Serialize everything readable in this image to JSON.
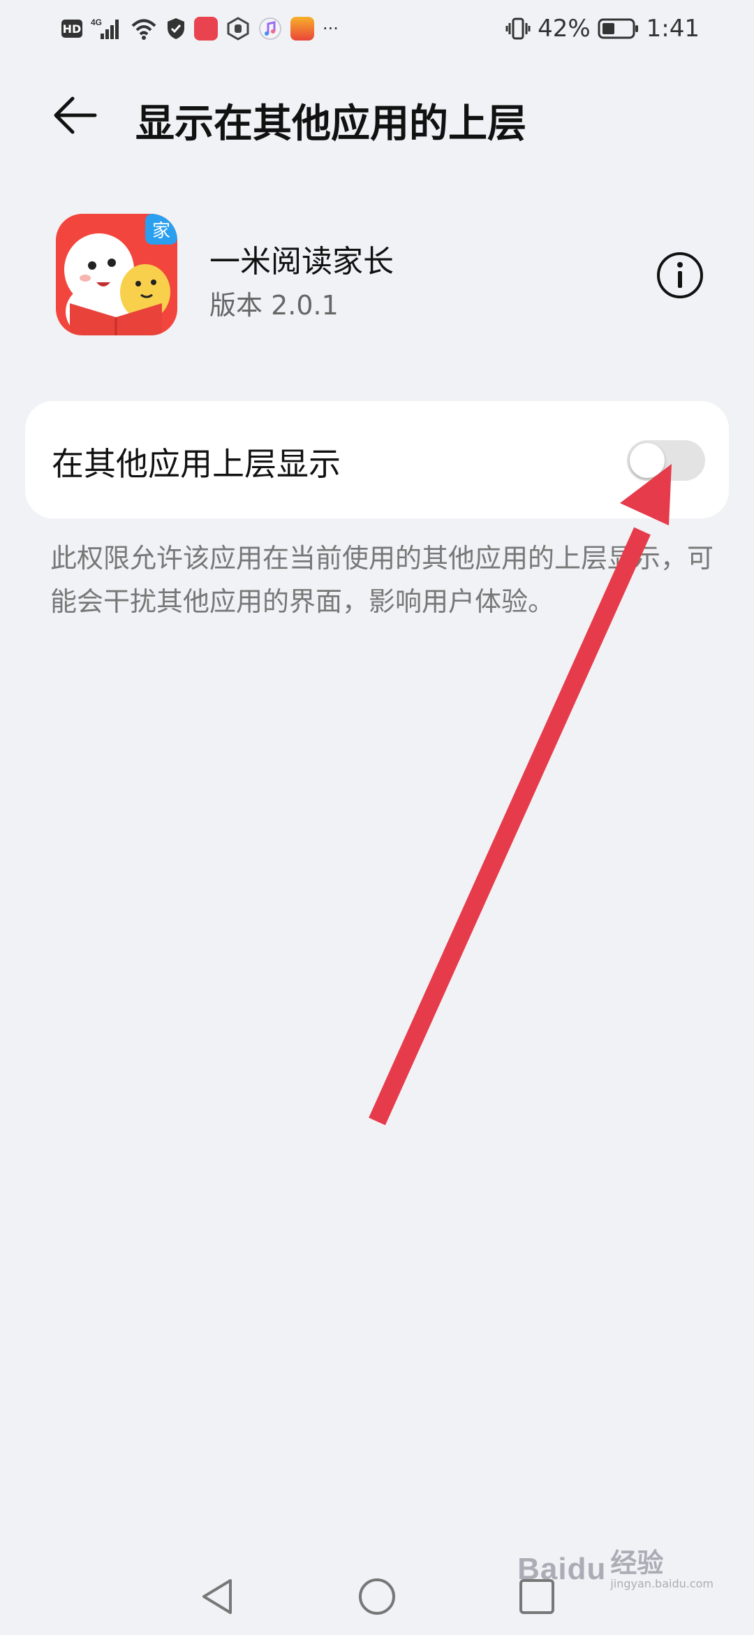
{
  "status_bar": {
    "left_icons": [
      "hd-icon",
      "4g-signal-icon",
      "wifi-icon",
      "shield-icon",
      "huawei-app-icon",
      "hand-app-icon",
      "music-app-icon",
      "huawei-store-icon",
      "more-icon"
    ],
    "hd_label": "HD",
    "network_label": "4G",
    "more_label": "···",
    "battery_percent": "42%",
    "battery_level": 0.42,
    "time": "1:41"
  },
  "header": {
    "title": "显示在其他应用的上层"
  },
  "app": {
    "name": "一米阅读家长",
    "version": "版本 2.0.1",
    "icon_badge": "家"
  },
  "setting": {
    "label": "在其他应用上层显示",
    "enabled": false
  },
  "description": "此权限允许该应用在当前使用的其他应用的上层显示，可能会干扰其他应用的界面，影响用户体验。",
  "watermark": {
    "logo": "Baidu",
    "text": "经验",
    "url": "jingyan.baidu.com"
  },
  "colors": {
    "background": "#f1f2f5",
    "card": "#ffffff",
    "arrow": "#e63b4b",
    "app_icon_red": "#f2453d",
    "app_badge_blue": "#2a9ff0"
  }
}
